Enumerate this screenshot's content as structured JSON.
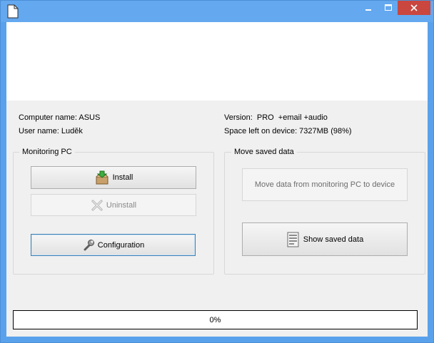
{
  "window": {
    "title": "",
    "controls": {
      "minimize": "—",
      "maximize": "☐",
      "close": "✕"
    }
  },
  "info": {
    "computer_name": "Computer name: ASUS",
    "user_name": "User name: Luděk",
    "version": "Version:  PRO  +email +audio",
    "space_left": "Space left on device: 7327MB (98%)"
  },
  "monitoring_group": {
    "title": "Monitoring PC",
    "install_label": "Install",
    "uninstall_label": "Uninstall",
    "configuration_label": "Configuration"
  },
  "move_group": {
    "title": "Move saved data",
    "move_label": "Move data from monitoring PC to device",
    "show_label": "Show saved data"
  },
  "progress": {
    "value": 0,
    "text": "0%"
  }
}
